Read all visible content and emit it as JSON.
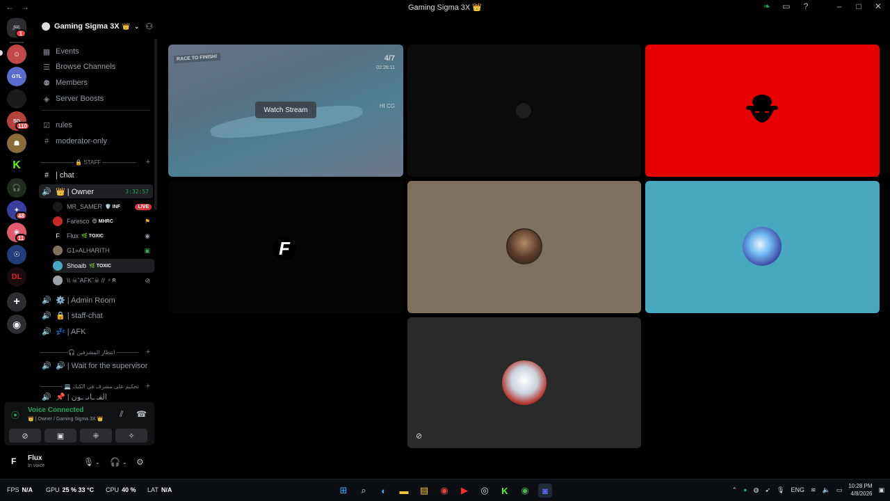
{
  "titlebar": {
    "title": "Gaming Sigma 3X 👑",
    "back": "←",
    "forward": "→"
  },
  "rail": {
    "badges": [
      "1",
      "110",
      "48",
      "11"
    ]
  },
  "server": {
    "name": "Gaming Sigma 3X",
    "crown": "👑",
    "chevron": "⌄"
  },
  "menu": {
    "events": "Events",
    "browse": "Browse Channels",
    "members": "Members",
    "boosts": "Server Boosts"
  },
  "channels": {
    "rules": "rules",
    "moderator": "moderator-only",
    "staff_category": "—————— 🔒 STAFF ——————",
    "chat": "| chat",
    "owner": "👑 | Owner",
    "owner_timer": "3:32:57",
    "admin_room": "⚙️ | Admin Room",
    "staff_chat": "🔒 | staff-chat",
    "afk": "💤 | AFK",
    "cat2": "—————🎧 انتظار المشرفين ————",
    "wait": "🔊 | Wait for the supervisor",
    "cat3": "———— 💻 تحكيم على مشرف في الكيك",
    "partial": "📌 | القـ ـانـ ـون"
  },
  "voice_users": [
    {
      "name": "MR_SAMER",
      "tag": "🛡️ INF",
      "live": "LIVE"
    },
    {
      "name": "Faresco",
      "tag": "😊 MHRC"
    },
    {
      "name": "Flux",
      "tag": "🌿 TOXIC"
    },
    {
      "name": "G1»ALHARITH",
      "tag": ""
    },
    {
      "name": "Shoaib",
      "tag": "🌿 TOXIC"
    },
    {
      "name": "\\\\ ☠︎˜AFK˜☠︎ //",
      "tag": "⚡ R"
    }
  ],
  "voice_panel": {
    "status": "Voice Connected",
    "sub": "👑 | Owner / Gaming Sigma 3X 👑"
  },
  "user": {
    "name": "Flux",
    "status": "In voice",
    "avatar": "F"
  },
  "stage": {
    "watch_stream": "Watch Stream",
    "stream_hud_left": "RACE TO FINISH!",
    "stream_hud_count": "4/7",
    "stream_hud_time": "02:26:11",
    "stream_hud_right": "HI CG",
    "flux_logo": "F"
  },
  "colors": {
    "red_tile": "#e60000",
    "tan_tile": "#80715f",
    "teal_tile": "#48a8bf",
    "dark_tile": "#2a2a2a",
    "green": "#23a55a"
  },
  "taskbar": {
    "fps_label": "FPS",
    "fps_value": "N/A",
    "gpu_label": "GPU",
    "gpu_value": "25 %  33 °C",
    "cpu_label": "CPU",
    "cpu_value": "40 %",
    "lat_label": "LAT",
    "lat_value": "N/A",
    "lang": "ENG",
    "time": "10:28 PM",
    "date": "4/8/2026"
  }
}
